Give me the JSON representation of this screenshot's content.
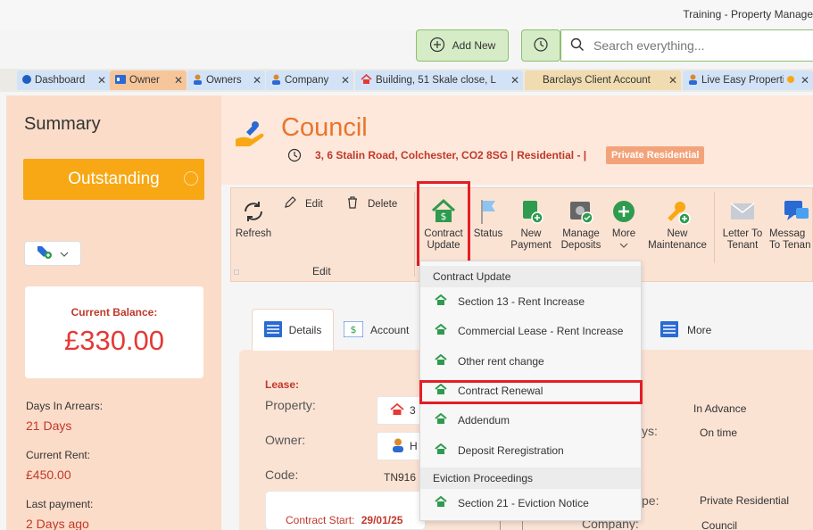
{
  "app_title": "Training - Property Manage",
  "toolbar": {
    "add_new": "Add New",
    "search_placeholder": "Search everything..."
  },
  "tabs": [
    {
      "label": "Dashboard",
      "bg": "#d3e3f7"
    },
    {
      "label": "Owner",
      "bg": "#f7c59a"
    },
    {
      "label": "Owners",
      "bg": "#d3e3f7"
    },
    {
      "label": "Company",
      "bg": "#d3e3f7"
    },
    {
      "label": "Building, 51 Skale close, L",
      "bg": "#d3e3f7"
    },
    {
      "label": "Barclays Client Account",
      "bg": "#f0dcb0"
    },
    {
      "label": "Live Easy Propertie",
      "bg": "#d3e3f7"
    }
  ],
  "summary": {
    "title": "Summary",
    "status": "Outstanding",
    "balance_label": "Current Balance:",
    "balance_value": "£330.00",
    "days_arrears_label": "Days In Arrears:",
    "days_arrears_value": "21 Days",
    "current_rent_label": "Current Rent:",
    "current_rent_value": "£450.00",
    "last_payment_label": "Last payment:",
    "last_payment_value": "2 Days ago"
  },
  "header": {
    "title": "Council",
    "address": "3, 6 Stalin Road,  Colchester, CO2 8SG | Residential -  |",
    "type_badge": "Private Residential"
  },
  "ribbon": {
    "refresh": "Refresh",
    "edit": "Edit",
    "delete": "Delete",
    "edit_group": "Edit",
    "contract_update_1": "Contract",
    "contract_update_2": "Update",
    "status": "Status",
    "new_payment_1": "New",
    "new_payment_2": "Payment",
    "manage_deposits_1": "Manage",
    "manage_deposits_2": "Deposits",
    "more": "More",
    "new_maintenance_1": "New",
    "new_maintenance_2": "Maintenance",
    "letter_1": "Letter To",
    "letter_2": "Tenant",
    "message_1": "Messag",
    "message_2": "To Tenan"
  },
  "content_tabs": {
    "details": "Details",
    "account": "Account",
    "more": "More"
  },
  "details": {
    "lease_label": "Lease:",
    "property_label": "Property:",
    "property_value": "3",
    "owner_label": "Owner:",
    "owner_value": "H",
    "code_label": "Code:",
    "code_value": "TN916",
    "contract_start_label": "Contract Start:",
    "contract_start_value": "29/01/25",
    "right_1": "In Advance",
    "right_2_label": "ys:",
    "right_2": "On time",
    "right_3_label": "pe:",
    "right_3": "Private Residential",
    "right_4_label": "Company:",
    "right_4": "Council"
  },
  "dropdown": {
    "header_1": "Contract Update",
    "items_1": [
      "Section 13 - Rent Increase",
      "Commercial Lease - Rent Increase",
      "Other rent change",
      "Contract Renewal",
      "Addendum",
      "Deposit Reregistration"
    ],
    "header_2": "Eviction Proceedings",
    "items_2": [
      "Section 21 - Eviction Notice"
    ]
  },
  "colors": {
    "accent_orange": "#e9742b",
    "highlight_red": "#e41e26",
    "status_orange": "#f7a814",
    "green": "#2e9b4e"
  }
}
